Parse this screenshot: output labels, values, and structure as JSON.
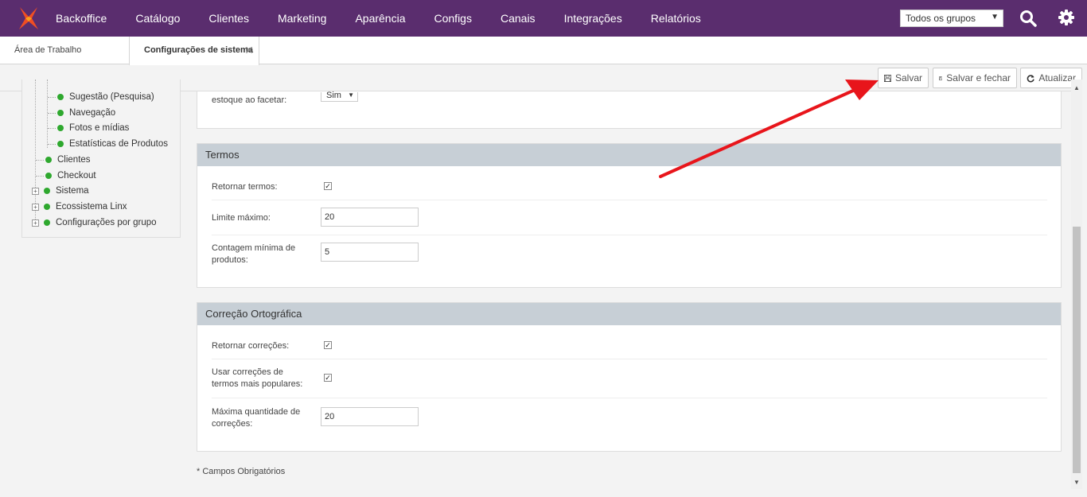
{
  "nav": {
    "items": [
      "Backoffice",
      "Catálogo",
      "Clientes",
      "Marketing",
      "Aparência",
      "Configs",
      "Canais",
      "Integrações",
      "Relatórios"
    ],
    "group_select": "Todos os grupos"
  },
  "tabs": {
    "workspace": "Área de Trabalho",
    "config": "Configurações de sistema"
  },
  "toolbar": {
    "save": "Salvar",
    "save_close": "Salvar e fechar",
    "refresh": "Atualizar"
  },
  "tree": {
    "children": [
      "Sugestão (Pesquisa)",
      "Navegação",
      "Fotos e mídias",
      "Estatísticas de Produtos"
    ],
    "roots": [
      "Clientes",
      "Checkout",
      "Sistema",
      "Ecossistema Linx",
      "Configurações por grupo"
    ]
  },
  "top_panel": {
    "label": "estoque ao facetar:",
    "select_value": "Sim"
  },
  "termos": {
    "title": "Termos",
    "return_terms": "Retornar termos:",
    "max_limit_label": "Limite máximo:",
    "max_limit_value": "20",
    "min_count_label": "Contagem mínima de produtos:",
    "min_count_value": "5"
  },
  "correcao": {
    "title": "Correção Ortográfica",
    "return_corrections": "Retornar correções:",
    "popular_corrections": "Usar correções de termos mais populares:",
    "max_qty_label": "Máxima quantidade de correções:",
    "max_qty_value": "20"
  },
  "footnote": "* Campos Obrigatórios",
  "colors": {
    "topbar": "#5a2d6e",
    "panel_header": "#c7cfd6",
    "status_dot": "#2ea82e",
    "annotation_arrow": "#e8151b"
  }
}
